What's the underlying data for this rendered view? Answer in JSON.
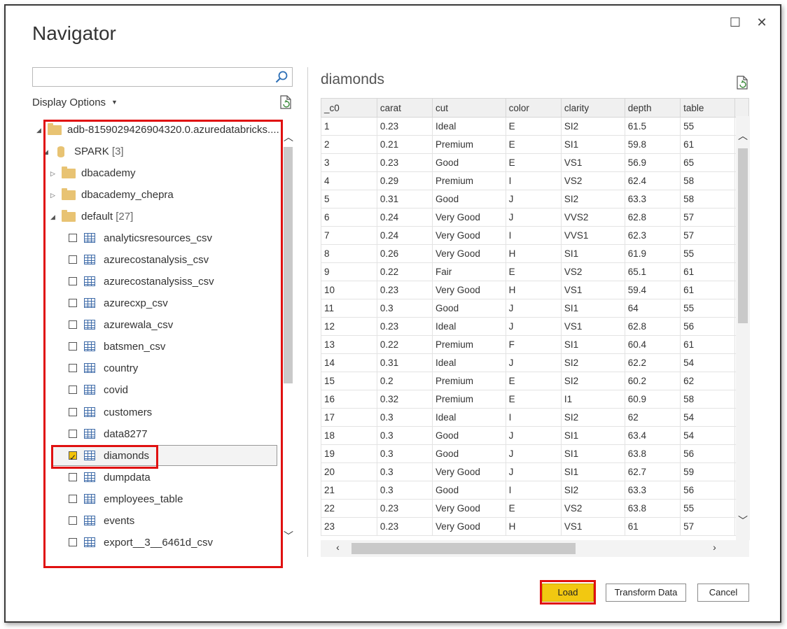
{
  "window": {
    "title": "Navigator",
    "maximize_glyph": "☐",
    "close_glyph": "✕"
  },
  "left": {
    "search": {
      "value": "",
      "placeholder": ""
    },
    "display_options_label": "Display Options",
    "tree": {
      "workspace": "adb-8159029426904320.0.azuredatabricks....",
      "catalog": {
        "name": "SPARK",
        "count": "[3]"
      },
      "schemas": [
        {
          "name": "dbacademy",
          "count": ""
        },
        {
          "name": "dbacademy_chepra",
          "count": ""
        },
        {
          "name": "default",
          "count": "[27]"
        }
      ],
      "tables": [
        {
          "name": "analyticsresources_csv",
          "checked": false
        },
        {
          "name": "azurecostanalysis_csv",
          "checked": false
        },
        {
          "name": "azurecostanalysiss_csv",
          "checked": false
        },
        {
          "name": "azurecxp_csv",
          "checked": false
        },
        {
          "name": "azurewala_csv",
          "checked": false
        },
        {
          "name": "batsmen_csv",
          "checked": false
        },
        {
          "name": "country",
          "checked": false
        },
        {
          "name": "covid",
          "checked": false
        },
        {
          "name": "customers",
          "checked": false
        },
        {
          "name": "data8277",
          "checked": false
        },
        {
          "name": "diamonds",
          "checked": true
        },
        {
          "name": "dumpdata",
          "checked": false
        },
        {
          "name": "employees_table",
          "checked": false
        },
        {
          "name": "events",
          "checked": false
        },
        {
          "name": "export__3__6461d_csv",
          "checked": false
        }
      ]
    }
  },
  "preview": {
    "title": "diamonds",
    "columns": [
      "_c0",
      "carat",
      "cut",
      "color",
      "clarity",
      "depth",
      "table"
    ],
    "rows": [
      [
        "1",
        "0.23",
        "Ideal",
        "E",
        "SI2",
        "61.5",
        "55"
      ],
      [
        "2",
        "0.21",
        "Premium",
        "E",
        "SI1",
        "59.8",
        "61"
      ],
      [
        "3",
        "0.23",
        "Good",
        "E",
        "VS1",
        "56.9",
        "65"
      ],
      [
        "4",
        "0.29",
        "Premium",
        "I",
        "VS2",
        "62.4",
        "58"
      ],
      [
        "5",
        "0.31",
        "Good",
        "J",
        "SI2",
        "63.3",
        "58"
      ],
      [
        "6",
        "0.24",
        "Very Good",
        "J",
        "VVS2",
        "62.8",
        "57"
      ],
      [
        "7",
        "0.24",
        "Very Good",
        "I",
        "VVS1",
        "62.3",
        "57"
      ],
      [
        "8",
        "0.26",
        "Very Good",
        "H",
        "SI1",
        "61.9",
        "55"
      ],
      [
        "9",
        "0.22",
        "Fair",
        "E",
        "VS2",
        "65.1",
        "61"
      ],
      [
        "10",
        "0.23",
        "Very Good",
        "H",
        "VS1",
        "59.4",
        "61"
      ],
      [
        "11",
        "0.3",
        "Good",
        "J",
        "SI1",
        "64",
        "55"
      ],
      [
        "12",
        "0.23",
        "Ideal",
        "J",
        "VS1",
        "62.8",
        "56"
      ],
      [
        "13",
        "0.22",
        "Premium",
        "F",
        "SI1",
        "60.4",
        "61"
      ],
      [
        "14",
        "0.31",
        "Ideal",
        "J",
        "SI2",
        "62.2",
        "54"
      ],
      [
        "15",
        "0.2",
        "Premium",
        "E",
        "SI2",
        "60.2",
        "62"
      ],
      [
        "16",
        "0.32",
        "Premium",
        "E",
        "I1",
        "60.9",
        "58"
      ],
      [
        "17",
        "0.3",
        "Ideal",
        "I",
        "SI2",
        "62",
        "54"
      ],
      [
        "18",
        "0.3",
        "Good",
        "J",
        "SI1",
        "63.4",
        "54"
      ],
      [
        "19",
        "0.3",
        "Good",
        "J",
        "SI1",
        "63.8",
        "56"
      ],
      [
        "20",
        "0.3",
        "Very Good",
        "J",
        "SI1",
        "62.7",
        "59"
      ],
      [
        "21",
        "0.3",
        "Good",
        "I",
        "SI2",
        "63.3",
        "56"
      ],
      [
        "22",
        "0.23",
        "Very Good",
        "E",
        "VS2",
        "63.8",
        "55"
      ],
      [
        "23",
        "0.23",
        "Very Good",
        "H",
        "VS1",
        "61",
        "57"
      ]
    ]
  },
  "buttons": {
    "load": "Load",
    "transform": "Transform Data",
    "cancel": "Cancel"
  },
  "colors": {
    "highlight_red": "#e01010",
    "load_yellow": "#f2c811",
    "folder": "#e8c373"
  }
}
